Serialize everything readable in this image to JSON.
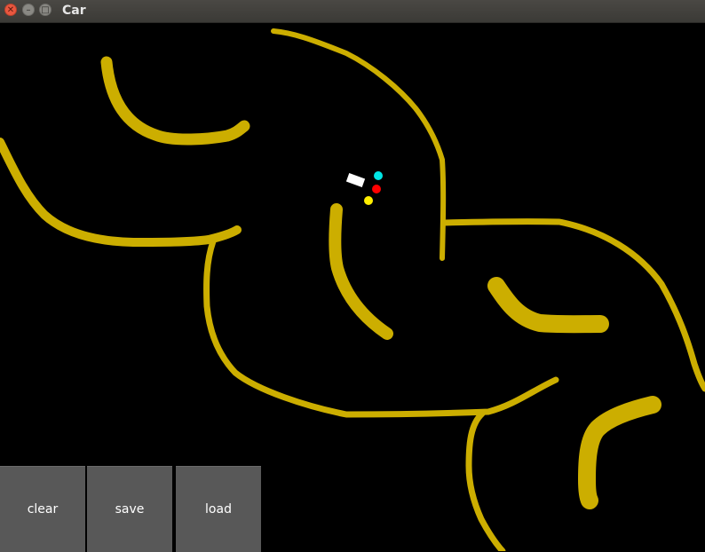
{
  "window": {
    "title": "Car"
  },
  "controls": {
    "clear_label": "clear",
    "save_label": "save",
    "load_label": "load"
  },
  "colors": {
    "track": "#ccae00",
    "car": "#ffffff",
    "sensor1": "#00e5e5",
    "sensor2": "#ff0000",
    "sensor3": "#ffee00"
  }
}
